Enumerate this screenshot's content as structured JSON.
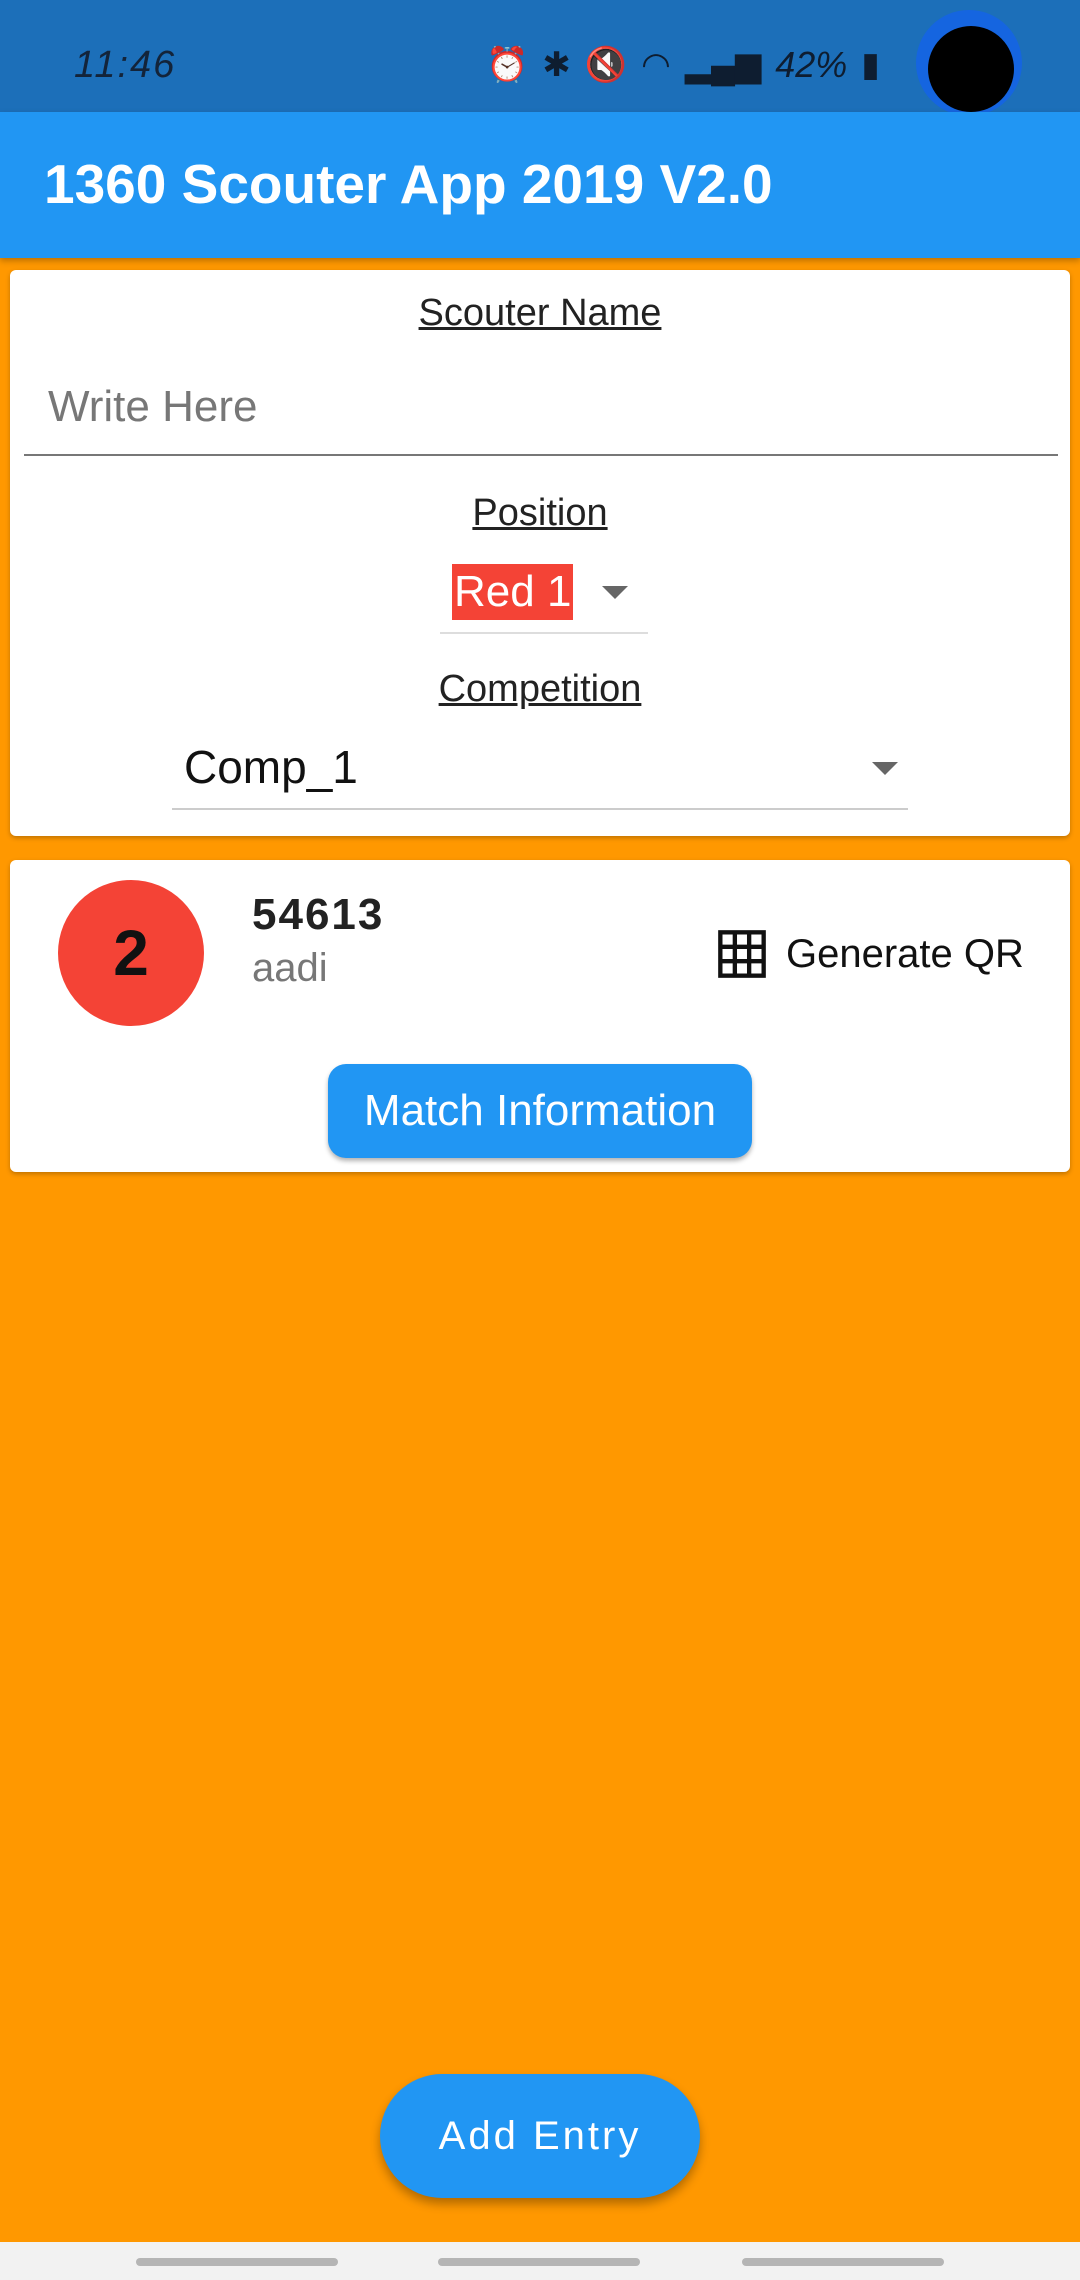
{
  "status_bar": {
    "time": "11:46",
    "battery": "42%"
  },
  "app_bar": {
    "title": "1360 Scouter App 2019 V2.0"
  },
  "form": {
    "scouter_name_label": "Scouter Name",
    "scouter_name_placeholder": "Write Here",
    "position_label": "Position",
    "position_value": "Red 1",
    "competition_label": "Competition",
    "competition_value": "Comp_1"
  },
  "match_card": {
    "match_badge": "2",
    "team_number": "54613",
    "scouter": "aadi",
    "qr_label": "Generate QR",
    "info_button": "Match Information"
  },
  "fab": {
    "label": "Add Entry"
  },
  "colors": {
    "background": "#FF9800",
    "primary": "#2196F3",
    "accent_red": "#F44336"
  }
}
